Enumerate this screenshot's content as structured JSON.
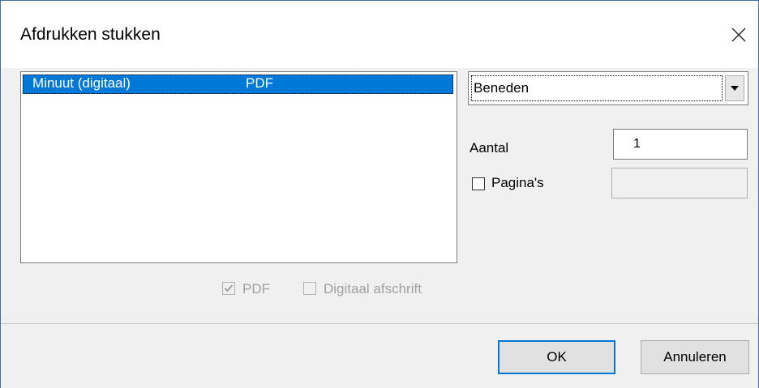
{
  "dialog": {
    "title": "Afdrukken stukken",
    "close_icon": "close-icon"
  },
  "list": {
    "rows": [
      {
        "name": "Minuut (digitaal)",
        "format": "PDF",
        "selected": true
      }
    ]
  },
  "options": {
    "tray_select": {
      "value": "Beneden",
      "arrow_icon": "dropdown-arrow-icon"
    },
    "aantal": {
      "label": "Aantal",
      "value": "1"
    },
    "paginas": {
      "label": "Pagina's",
      "checked": false,
      "value": ""
    }
  },
  "checkboxes": {
    "pdf": {
      "label": "PDF",
      "checked": true,
      "enabled": false
    },
    "digitaal_afschrift": {
      "label": "Digitaal afschrift",
      "checked": false,
      "enabled": false
    }
  },
  "buttons": {
    "ok": "OK",
    "cancel": "Annuleren"
  }
}
